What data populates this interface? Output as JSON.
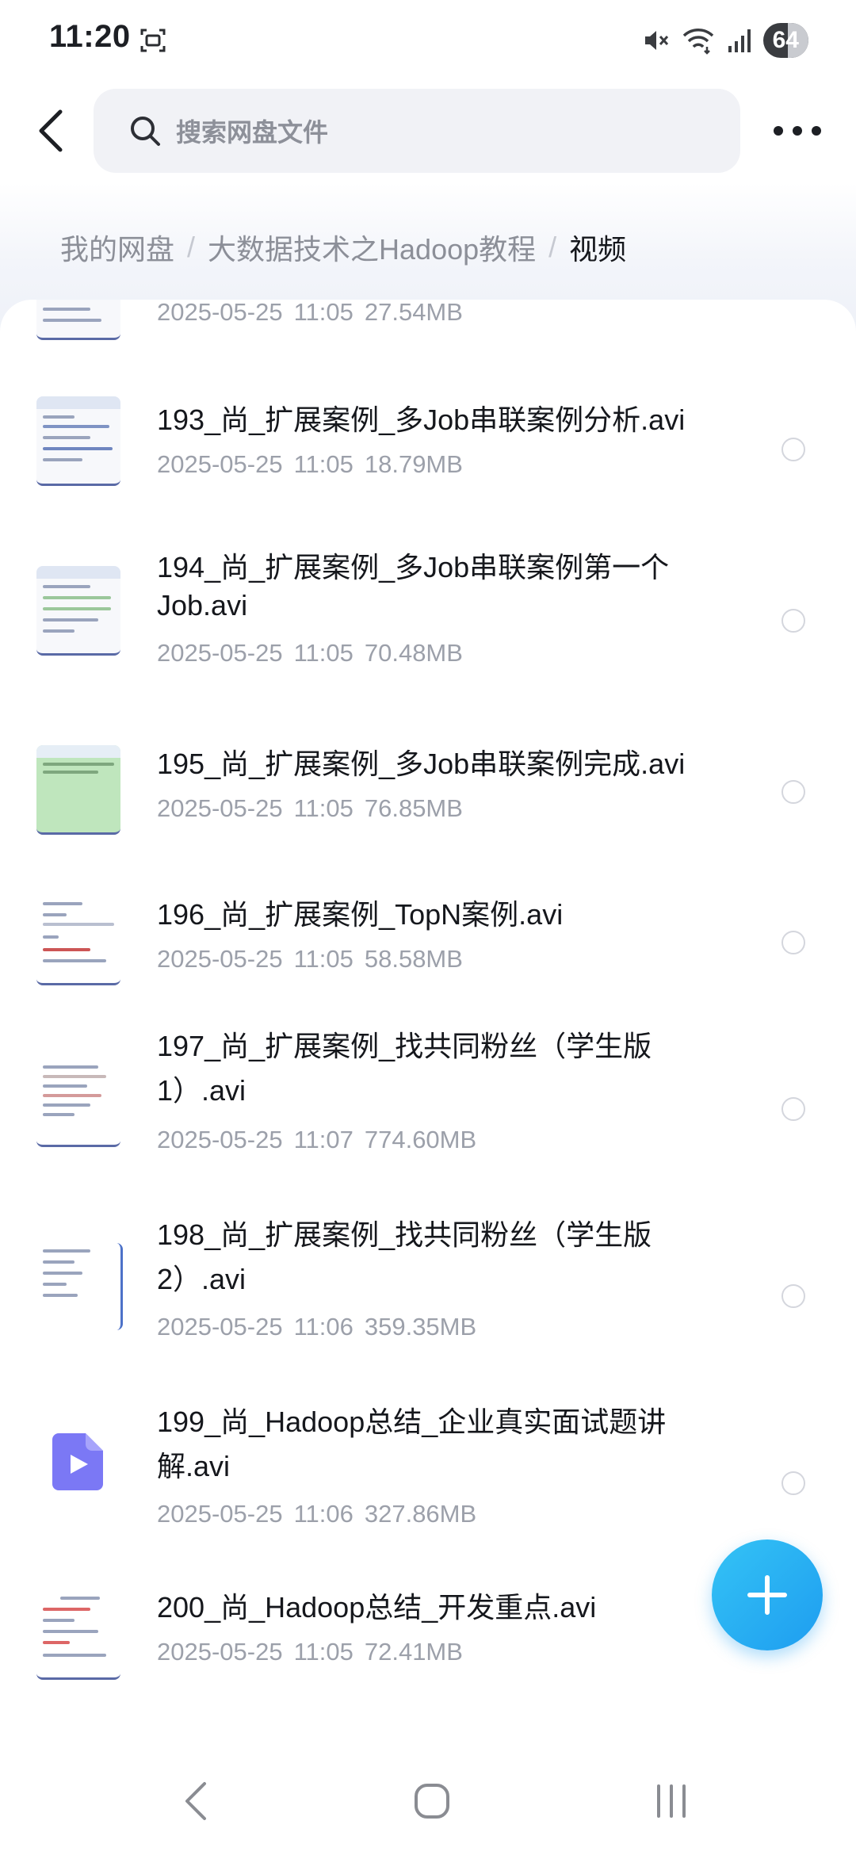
{
  "status_bar": {
    "time": "11:20",
    "battery": "64"
  },
  "search": {
    "placeholder": "搜索网盘文件"
  },
  "breadcrumb": {
    "items": [
      "我的网盘",
      "大数据技术之Hadoop教程",
      "视频"
    ],
    "separator": "/"
  },
  "files": [
    {
      "name": "",
      "date": "2025-05-25",
      "time": "11:05",
      "size": "27.54MB"
    },
    {
      "name": "193_尚_扩展案例_多Job串联案例分析.avi",
      "date": "2025-05-25",
      "time": "11:05",
      "size": "18.79MB"
    },
    {
      "name_line1": "194_尚_扩展案例_多Job串联案例第一个",
      "name_line2": "Job.avi",
      "date": "2025-05-25",
      "time": "11:05",
      "size": "70.48MB"
    },
    {
      "name": "195_尚_扩展案例_多Job串联案例完成.avi",
      "date": "2025-05-25",
      "time": "11:05",
      "size": "76.85MB"
    },
    {
      "name": "196_尚_扩展案例_TopN案例.avi",
      "date": "2025-05-25",
      "time": "11:05",
      "size": "58.58MB"
    },
    {
      "name_line1": "197_尚_扩展案例_找共同粉丝（学生版",
      "name_line2": "1）.avi",
      "date": "2025-05-25",
      "time": "11:07",
      "size": "774.60MB"
    },
    {
      "name_line1": "198_尚_扩展案例_找共同粉丝（学生版",
      "name_line2": "2）.avi",
      "date": "2025-05-25",
      "time": "11:06",
      "size": "359.35MB"
    },
    {
      "name_line1": "199_尚_Hadoop总结_企业真实面试题讲",
      "name_line2": "解.avi",
      "date": "2025-05-25",
      "time": "11:06",
      "size": "327.86MB"
    },
    {
      "name": "200_尚_Hadoop总结_开发重点.avi",
      "date": "2025-05-25",
      "time": "11:05",
      "size": "72.41MB"
    }
  ],
  "icons": {
    "back": "chevron-left-icon",
    "search": "search-icon",
    "more": "more-horizontal-icon",
    "add": "plus-icon",
    "video": "video-file-icon"
  },
  "colors": {
    "accent": "#1e9df0",
    "video_icon": "#7b78f5"
  }
}
